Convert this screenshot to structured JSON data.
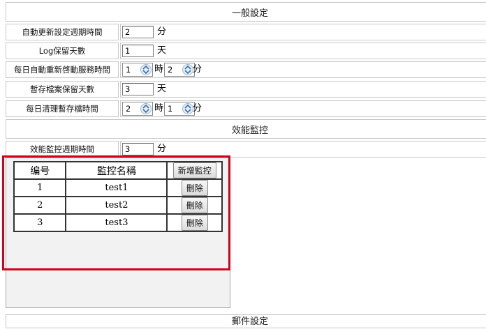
{
  "general": {
    "title": "一般設定",
    "rows": {
      "auto_update": {
        "label": "自動更新設定週期時間",
        "value": "2",
        "unit": "分"
      },
      "log_keep": {
        "label": "Log保留天數",
        "value": "1",
        "unit": "天"
      },
      "daily_restart": {
        "label": "每日自動重新啓動服務時間",
        "hour": "1",
        "hour_unit": "時",
        "minute": "2",
        "minute_unit": "分"
      },
      "temp_keep": {
        "label": "暫存檔案保留天數",
        "value": "3",
        "unit": "天"
      },
      "daily_clean": {
        "label": "每日清理暫存檔時間",
        "hour": "2",
        "hour_unit": "時",
        "minute": "1",
        "minute_unit": "分"
      }
    }
  },
  "performance": {
    "title": "效能監控",
    "period": {
      "label": "效能監控週期時間",
      "value": "3",
      "unit": "分"
    },
    "table": {
      "headers": {
        "id": "编号",
        "name": "監控名稱",
        "add_button": "新增監控"
      },
      "rows": [
        {
          "id": "1",
          "name": "test1",
          "action": "刪除"
        },
        {
          "id": "2",
          "name": "test2",
          "action": "刪除"
        },
        {
          "id": "3",
          "name": "test3",
          "action": "刪除"
        }
      ]
    }
  },
  "next_section": {
    "title": "郵件設定"
  },
  "colors": {
    "highlight": "#d0021b",
    "spinner_button": "#e3eef9"
  }
}
